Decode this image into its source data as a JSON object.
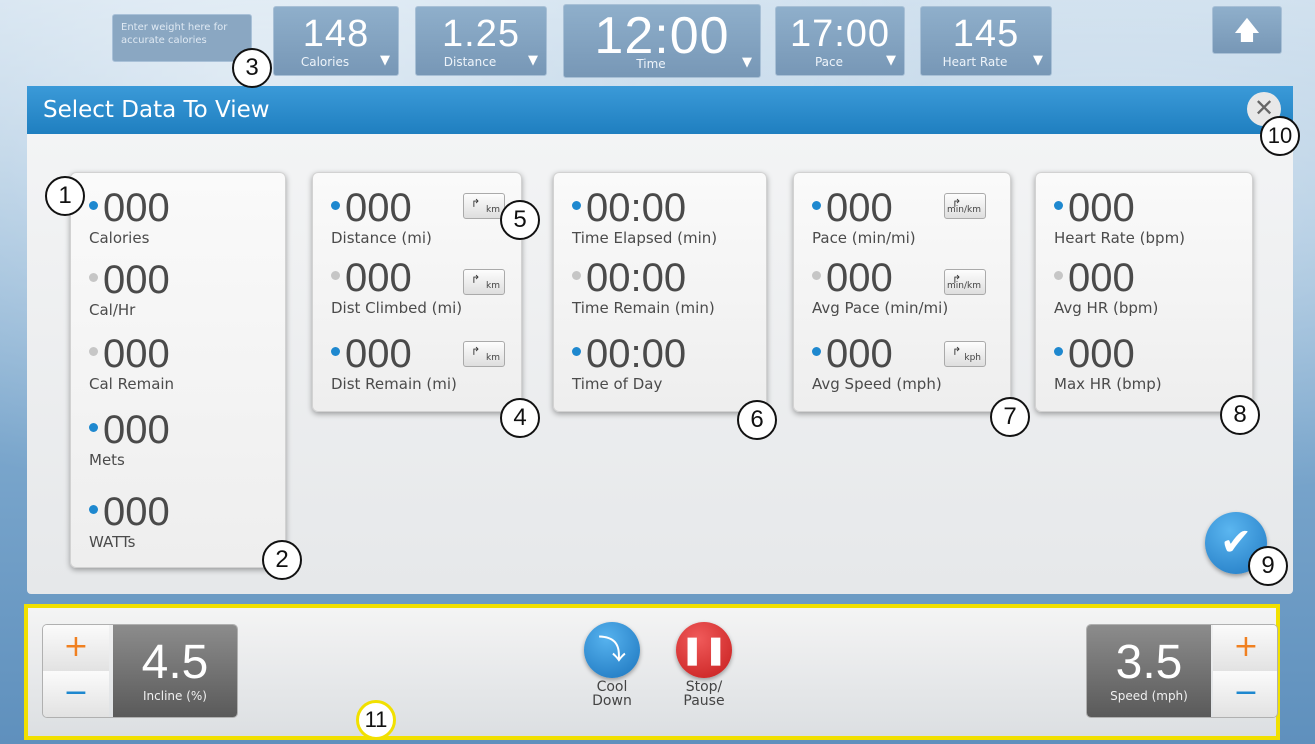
{
  "weight_prompt": "Enter weight here for accurate calories",
  "metrics": [
    {
      "value": "148",
      "label": "Calories"
    },
    {
      "value": "1.25",
      "label": "Distance"
    },
    {
      "value": "12:00",
      "label": "Time"
    },
    {
      "value": "17:00",
      "label": "Pace"
    },
    {
      "value": "145",
      "label": "Heart Rate"
    }
  ],
  "panel": {
    "title": "Select Data To View"
  },
  "cards": {
    "calories": [
      {
        "value": "000",
        "label": "Calories",
        "selected": true
      },
      {
        "value": "000",
        "label": "Cal/Hr",
        "selected": false
      },
      {
        "value": "000",
        "label": "Cal Remain",
        "selected": false
      },
      {
        "value": "000",
        "label": "Mets",
        "selected": true
      },
      {
        "value": "000",
        "label": "WATTs",
        "selected": true
      }
    ],
    "distance": [
      {
        "value": "000",
        "label": "Distance (mi)",
        "selected": true,
        "unit_toggle": "km"
      },
      {
        "value": "000",
        "label": "Dist Climbed (mi)",
        "selected": false,
        "unit_toggle": "km"
      },
      {
        "value": "000",
        "label": "Dist Remain (mi)",
        "selected": true,
        "unit_toggle": "km"
      }
    ],
    "time": [
      {
        "value": "00:00",
        "label": "Time Elapsed (min)",
        "selected": true
      },
      {
        "value": "00:00",
        "label": "Time Remain (min)",
        "selected": false
      },
      {
        "value": "00:00",
        "label": "Time of Day",
        "selected": true
      }
    ],
    "pace": [
      {
        "value": "000",
        "label": "Pace (min/mi)",
        "selected": true,
        "unit_toggle": "min/km"
      },
      {
        "value": "000",
        "label": "Avg Pace (min/mi)",
        "selected": false,
        "unit_toggle": "min/km"
      },
      {
        "value": "000",
        "label": "Avg Speed (mph)",
        "selected": true,
        "unit_toggle": "kph"
      }
    ],
    "heart_rate": [
      {
        "value": "000",
        "label": "Heart Rate (bpm)",
        "selected": true
      },
      {
        "value": "000",
        "label": "Avg HR (bpm)",
        "selected": false
      },
      {
        "value": "000",
        "label": "Max HR (bmp)",
        "selected": true
      }
    ]
  },
  "callouts": [
    "1",
    "2",
    "3",
    "4",
    "5",
    "6",
    "7",
    "8",
    "9",
    "10",
    "11"
  ],
  "bottom": {
    "incline": {
      "value": "4.5",
      "label": "Incline (%)"
    },
    "speed": {
      "value": "3.5",
      "label": "Speed (mph)"
    },
    "cool_down_line1": "Cool",
    "cool_down_line2": "Down",
    "stop_line1": "Stop/",
    "stop_line2": "Pause",
    "plus": "+",
    "minus": "−"
  },
  "colors": {
    "accent": "#1e88cf",
    "header": "#2a8ccd",
    "stop": "#d42a2a",
    "highlight": "#f1e000",
    "plus": "#f08020"
  },
  "icons": {
    "dropdown": "triangle-down-icon",
    "up": "arrow-up-icon",
    "close": "close-icon",
    "check": "check-icon",
    "cool_down": "cool-down-icon",
    "pause": "pause-icon"
  }
}
